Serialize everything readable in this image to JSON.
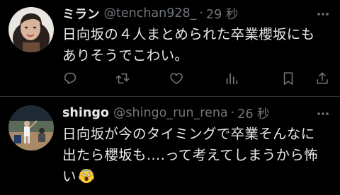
{
  "tweets": [
    {
      "display_name": "ミラン",
      "handle": "@tenchan928_",
      "time": "29 秒",
      "text_lines": [
        "日向坂の４人まとめられた卒業櫻坂にも",
        "ありそうでこわい。"
      ],
      "avatar": "woman-portrait-avatar"
    },
    {
      "display_name": "shingo",
      "handle": "@shingo_run_rena",
      "time": "26 秒",
      "text_lines": [
        "日向坂が今のタイミングで卒業そんなに",
        "出たら櫻坂も….って考えてしまうから怖",
        "い"
      ],
      "avatar": "baseball-player-avatar",
      "emoji": "screaming-face-emoji"
    }
  ],
  "actions": [
    "reply-icon",
    "retweet-icon",
    "like-icon",
    "views-icon",
    "bookmark-icon",
    "share-icon"
  ],
  "colors": {
    "background": "#000000",
    "text": "#e7e9ea",
    "secondary": "#71767b",
    "divider": "#2f3336"
  }
}
